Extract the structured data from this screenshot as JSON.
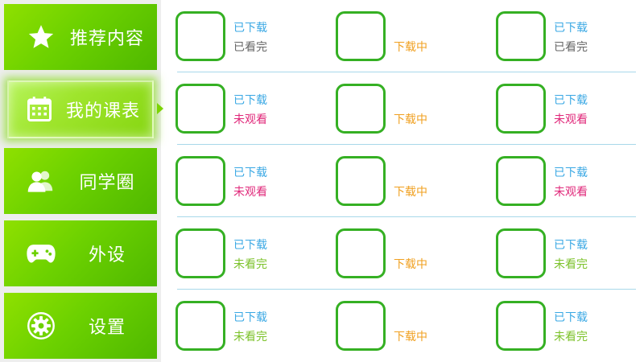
{
  "sidebar": {
    "items": [
      {
        "label": "推荐内容",
        "icon": "star-icon",
        "active": false
      },
      {
        "label": "我的课表",
        "icon": "calendar-icon",
        "active": true
      },
      {
        "label": "同学圈",
        "icon": "people-icon",
        "active": false
      },
      {
        "label": "外设",
        "icon": "gamepad-icon",
        "active": false
      },
      {
        "label": "设置",
        "icon": "gear-icon",
        "active": false
      }
    ]
  },
  "colors": {
    "downloaded": "#3aa8e4",
    "downloading": "#f0a020",
    "unwatched": "#e0287a",
    "finished": "#666666",
    "not_finished": "#7cc22a",
    "thumb_border": "#35b023",
    "divider": "#a8d8ea"
  },
  "grid": {
    "rows": [
      [
        {
          "top": "已下载",
          "bottom": "已看完",
          "bottom_color": "finished"
        },
        {
          "top": "",
          "bottom": "下载中",
          "bottom_color": "downloading"
        },
        {
          "top": "已下载",
          "bottom": "已看完",
          "bottom_color": "finished"
        }
      ],
      [
        {
          "top": "已下载",
          "bottom": "未观看",
          "bottom_color": "unwatched"
        },
        {
          "top": "",
          "bottom": "下载中",
          "bottom_color": "downloading"
        },
        {
          "top": "已下载",
          "bottom": "未观看",
          "bottom_color": "unwatched"
        }
      ],
      [
        {
          "top": "已下载",
          "bottom": "未观看",
          "bottom_color": "unwatched"
        },
        {
          "top": "",
          "bottom": "下载中",
          "bottom_color": "downloading"
        },
        {
          "top": "已下载",
          "bottom": "未观看",
          "bottom_color": "unwatched"
        }
      ],
      [
        {
          "top": "已下载",
          "bottom": "未看完",
          "bottom_color": "not_finished"
        },
        {
          "top": "",
          "bottom": "下载中",
          "bottom_color": "downloading"
        },
        {
          "top": "已下载",
          "bottom": "未看完",
          "bottom_color": "not_finished"
        }
      ],
      [
        {
          "top": "已下载",
          "bottom": "未看完",
          "bottom_color": "not_finished"
        },
        {
          "top": "",
          "bottom": "下载中",
          "bottom_color": "downloading"
        },
        {
          "top": "已下载",
          "bottom": "未看完",
          "bottom_color": "not_finished"
        }
      ]
    ]
  }
}
